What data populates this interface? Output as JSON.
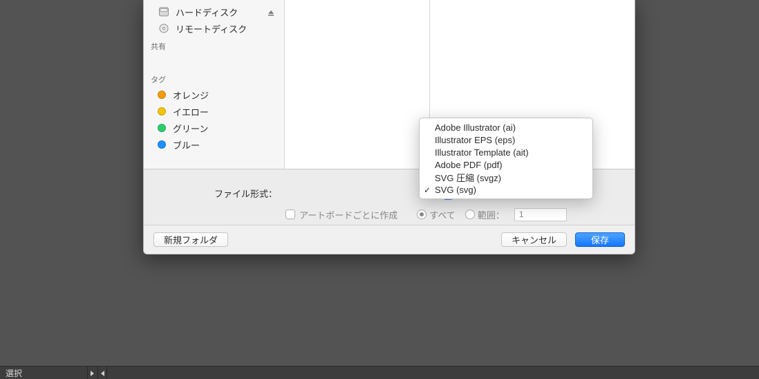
{
  "sidebar": {
    "devices": [
      {
        "label": "ハードディスク",
        "icon": "hdd"
      },
      {
        "label": "リモートディスク",
        "icon": "remote-disc"
      }
    ],
    "shared_heading": "共有",
    "tags_heading": "タグ",
    "tags": [
      {
        "label": "オレンジ",
        "color": "#f39c12"
      },
      {
        "label": "イエロー",
        "color": "#f1c40f"
      },
      {
        "label": "グリーン",
        "color": "#2ecc71"
      },
      {
        "label": "ブルー",
        "color": "#1e90ff"
      }
    ]
  },
  "options": {
    "format_label": "ファイル形式：",
    "per_artboard_label": "アートボードごとに作成",
    "all_label": "すべて",
    "range_label": "範囲：",
    "range_value": "1"
  },
  "buttons": {
    "new_folder": "新規フォルダ",
    "cancel": "キャンセル",
    "save": "保存"
  },
  "format_menu": {
    "items": [
      "Adobe Illustrator (ai)",
      "Illustrator EPS (eps)",
      "Illustrator Template (ait)",
      "Adobe PDF (pdf)",
      "SVG 圧縮 (svgz)",
      "SVG (svg)"
    ],
    "selected_index": 5
  },
  "statusbar": {
    "selection_label": "選択"
  }
}
